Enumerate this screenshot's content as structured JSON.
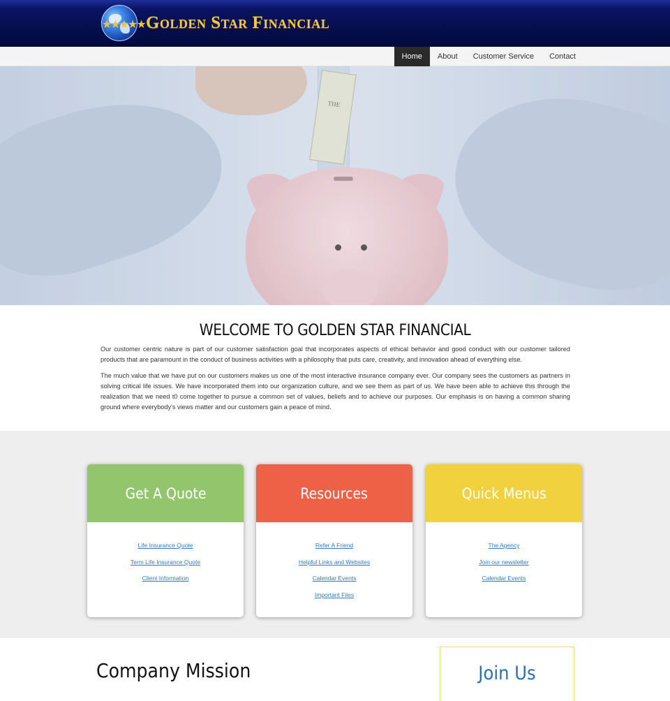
{
  "header": {
    "brand": "Golden Star Financial",
    "logo_icon": "globe-star-icon",
    "brand_color": "#f3c64a",
    "bg_color": "#061054"
  },
  "nav": {
    "items": [
      {
        "label": "Home",
        "active": true
      },
      {
        "label": "About",
        "active": false
      },
      {
        "label": "Customer Service",
        "active": false
      },
      {
        "label": "Contact",
        "active": false
      }
    ]
  },
  "hero": {
    "image": "hand-inserting-dollar-bill-into-piggy-bank",
    "bill_text": "THE"
  },
  "welcome": {
    "title": "WELCOME TO GOLDEN STAR FINANCIAL",
    "paragraph1": "Our customer centric nature is part of our customer satisfaction goal that incorporates aspects of ethical behavior and good conduct with our customer tailored products that are paramount in the conduct of business activities with a philosophy that puts care, creativity, and innovation ahead of everything else.",
    "paragraph2": "The much value that we have put on our customers makes us one of the most interactive insurance company ever. Our company sees the customers as partners in solving critical life issues. We have incorporated them into our organization culture, and we see them as part of us. We have been able to achieve this through the realization that we need t0 come together to pursue a common set of values, beliefs and to achieve our purposes. Our emphasis is on having a common sharing ground where everybody's views matter and our customers gain a peace of mind."
  },
  "cards": [
    {
      "title": "Get A Quote",
      "color": "#92c56c",
      "links": [
        "Life Insurance Quote",
        "Term Life Insurance Quote",
        "Client Information"
      ]
    },
    {
      "title": "Resources",
      "color": "#ef6146",
      "links": [
        "Refer A Friend",
        "Helpful Links and Websites",
        "Calendar Events",
        "Important Files"
      ]
    },
    {
      "title": "Quick Menus",
      "color": "#f2d13f",
      "links": [
        "The Agency",
        "Join our newsletter",
        "Calendar Events"
      ]
    }
  ],
  "bottom": {
    "mission_title": "Company Mission",
    "join_title": "Join Us"
  }
}
